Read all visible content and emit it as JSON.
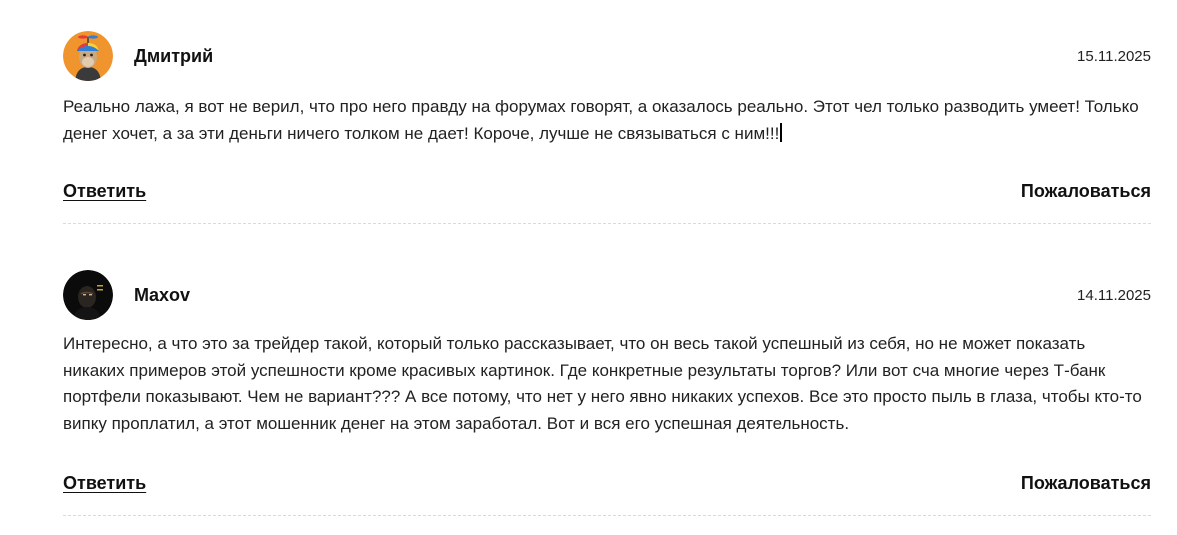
{
  "comments": [
    {
      "author": "Дмитрий",
      "date": "15.11.2025",
      "avatar_icon": "cartoon-ape-with-propeller-cap-icon",
      "text": "Реально лажа, я вот не верил, что про него правду на форумах говорят, а оказалось реально. Этот чел только разводить умеет! Только денег хочет, а за эти деньги ничего толком не дает! Короче, лучше не связываться с ним!!!",
      "reply_label": "Ответить",
      "report_label": "Пожаловаться"
    },
    {
      "author": "Maxov",
      "date": "14.11.2025",
      "avatar_icon": "dark-portrait-photo-icon",
      "text": "Интересно, а что это за трейдер такой, который только рассказывает, что он весь такой успешный из себя, но не может показать никаких примеров этой успешности кроме красивых картинок. Где конкретные результаты торгов? Или вот сча многие через Т-банк портфели показывают. Чем не вариант??? А все потому, что нет у него явно никаких успехов. Все это просто пыль в глаза, чтобы кто-то випку проплатил, а этот мошенник денег на этом заработал. Вот и вся его успешная деятельность.",
      "reply_label": "Ответить",
      "report_label": "Пожаловаться"
    }
  ],
  "colors": {
    "text": "#222222",
    "divider": "#d9d9d9",
    "avatar1_bg": "#f0952e",
    "avatar2_bg": "#0b0b0b"
  }
}
